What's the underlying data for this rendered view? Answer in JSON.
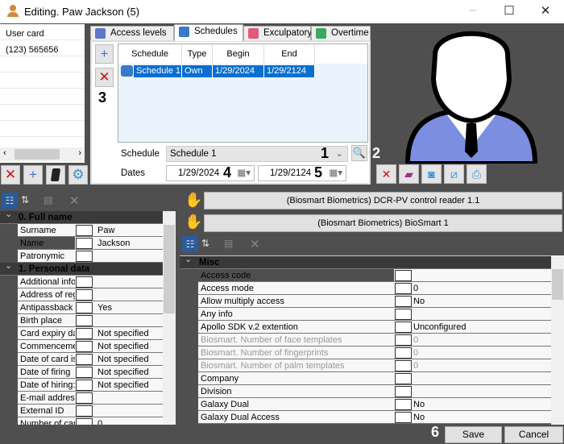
{
  "window": {
    "title": "Editing. Paw Jackson (5)",
    "minimize": "–",
    "maximize": "☐",
    "close": "✕"
  },
  "left_list": {
    "items": [
      "User card",
      "(123) 565656"
    ]
  },
  "tabs": [
    {
      "label": "Access levels",
      "color": "#5a7ac8"
    },
    {
      "label": "Schedules",
      "color": "#3a78c8"
    },
    {
      "label": "Exculpatory",
      "color": "#e05a7a"
    },
    {
      "label": "Overtime",
      "color": "#3aa860"
    }
  ],
  "schedules": {
    "columns": [
      "Schedule",
      "Type",
      "Begin",
      "End"
    ],
    "rows": [
      [
        "Schedule 1",
        "Own",
        "1/29/2024",
        "1/29/2124"
      ]
    ],
    "schedule_label": "Schedule",
    "schedule_value": "Schedule 1",
    "dates_label": "Dates",
    "date_begin": "1/29/2024",
    "date_end": "1/29/2124"
  },
  "callouts": [
    "1",
    "2",
    "3",
    "4",
    "5",
    "6"
  ],
  "devices": [
    "(Biosmart Biometrics) DCR-PV control reader 1.1",
    "(Biosmart Biometrics) BioSmart 1"
  ],
  "left_grid": [
    {
      "type": "cat",
      "label": "0. Full name"
    },
    {
      "label": "Surname",
      "value": "Paw"
    },
    {
      "label": "Name",
      "value": "Jackson",
      "sel": true
    },
    {
      "label": "Patronymic",
      "value": ""
    },
    {
      "type": "cat",
      "label": "1. Personal data"
    },
    {
      "label": "Additional info",
      "value": ""
    },
    {
      "label": "Address of reg",
      "value": ""
    },
    {
      "label": "Antipassback",
      "value": "Yes"
    },
    {
      "label": "Birth place",
      "value": ""
    },
    {
      "label": "Card expiry da",
      "value": "Not specified"
    },
    {
      "label": "Commenceme",
      "value": "Not specified"
    },
    {
      "label": "Date of card is",
      "value": "Not specified"
    },
    {
      "label": "Date of firing",
      "value": "Not specified"
    },
    {
      "label": "Date of hiring:",
      "value": "Not specified"
    },
    {
      "label": "E-mail address",
      "value": ""
    },
    {
      "label": "External ID",
      "value": ""
    },
    {
      "label": "Number of car",
      "value": "0"
    }
  ],
  "right_grid": [
    {
      "type": "cat",
      "label": "Misc"
    },
    {
      "label": "Access code",
      "value": "",
      "sel": true
    },
    {
      "label": "Access mode",
      "value": "0"
    },
    {
      "label": "Allow multiply access",
      "value": "No"
    },
    {
      "label": "Any info",
      "value": ""
    },
    {
      "label": "Apollo SDK v.2 extention",
      "value": "Unconfigured"
    },
    {
      "label": "Biosmart. Number of face templates",
      "value": "0",
      "dis": true
    },
    {
      "label": "Biosmart. Number of fingerprints",
      "value": "0",
      "dis": true
    },
    {
      "label": "Biosmart. Number of palm templates",
      "value": "0",
      "dis": true
    },
    {
      "label": "Company",
      "value": ""
    },
    {
      "label": "Division",
      "value": ""
    },
    {
      "label": "Galaxy Dual",
      "value": "No"
    },
    {
      "label": "Galaxy Dual Access",
      "value": "No"
    }
  ],
  "footer": {
    "save": "Save",
    "cancel": "Cancel"
  }
}
